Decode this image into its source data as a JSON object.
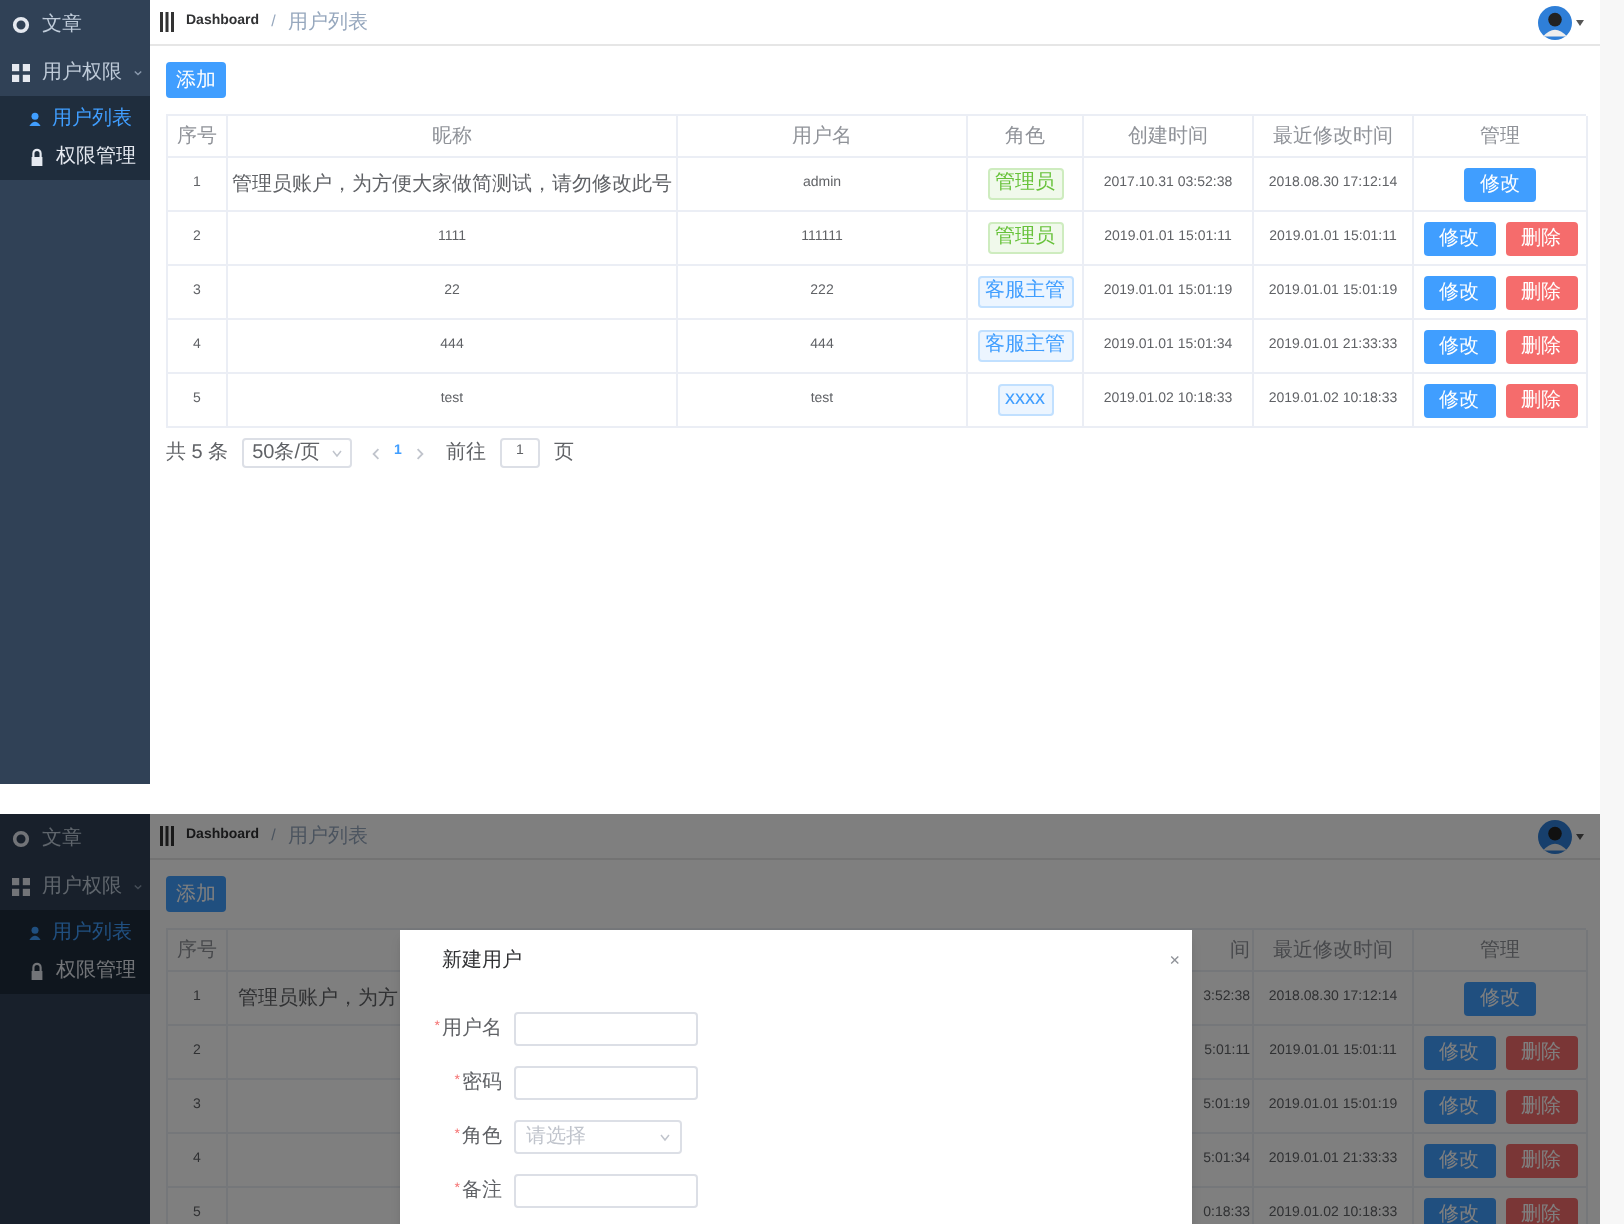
{
  "screens": [
    {
      "kind": "list",
      "sidebar": {
        "items": [
          {
            "label": "文章"
          },
          {
            "label": "用户权限",
            "expanded": true,
            "children": [
              {
                "label": "用户列表",
                "selected": true
              },
              {
                "label": "权限管理",
                "selected": false
              }
            ]
          }
        ]
      },
      "breadcrumb": {
        "items": [
          "Dashboard",
          "用户列表"
        ],
        "separator": "/"
      },
      "add_button": "添加",
      "table": {
        "columns": {
          "index": "序号",
          "nickname": "昵称",
          "username": "用户名",
          "role": "角色",
          "created": "创建时间",
          "modified": "最近修改时间",
          "actions": "管理"
        },
        "rows": [
          {
            "index": "1",
            "nickname": "管理员账户，为方便大家做简测试，请勿修改此号",
            "username": "admin",
            "role": {
              "label": "管理员",
              "color": "#67c23a"
            },
            "created": "2017.10.31 03:52:38",
            "modified": "2018.08.30 17:12:14",
            "actions": [
              {
                "label": "修改",
                "kind": "edit"
              }
            ]
          },
          {
            "index": "2",
            "nickname": "1111",
            "username": "111111",
            "role": {
              "label": "管理员",
              "color": "#67c23a"
            },
            "created": "2019.01.01 15:01:11",
            "modified": "2019.01.01 15:01:11",
            "actions": [
              {
                "label": "修改",
                "kind": "edit"
              },
              {
                "label": "删除",
                "kind": "delete"
              }
            ]
          },
          {
            "index": "3",
            "nickname": "22",
            "username": "222",
            "role": {
              "label": "客服主管",
              "color": "#409eff"
            },
            "created": "2019.01.01 15:01:19",
            "modified": "2019.01.01 15:01:19",
            "actions": [
              {
                "label": "修改",
                "kind": "edit"
              },
              {
                "label": "删除",
                "kind": "delete"
              }
            ]
          },
          {
            "index": "4",
            "nickname": "444",
            "username": "444",
            "role": {
              "label": "客服主管",
              "color": "#409eff"
            },
            "created": "2019.01.01 15:01:34",
            "modified": "2019.01.01 21:33:33",
            "actions": [
              {
                "label": "修改",
                "kind": "edit"
              },
              {
                "label": "删除",
                "kind": "delete"
              }
            ]
          },
          {
            "index": "5",
            "nickname": "test",
            "username": "test",
            "role": {
              "label": "xxxx",
              "color": "#409eff"
            },
            "created": "2019.01.02 10:18:33",
            "modified": "2019.01.02 10:18:33",
            "actions": [
              {
                "label": "修改",
                "kind": "edit"
              },
              {
                "label": "删除",
                "kind": "delete"
              }
            ]
          }
        ]
      },
      "pagination": {
        "total": "共 5 条",
        "page_size": "50条/页",
        "pages": [
          {
            "label": "1",
            "selected": true
          }
        ],
        "goto": "前往",
        "goto_value": "1",
        "suffix": "页"
      }
    },
    {
      "kind": "dialog",
      "sidebar": {
        "items": [
          {
            "label": "文章"
          },
          {
            "label": "用户权限",
            "expanded": true,
            "children": [
              {
                "label": "用户列表",
                "selected": true
              },
              {
                "label": "权限管理",
                "selected": false
              }
            ]
          }
        ]
      },
      "breadcrumb": {
        "items": [
          "Dashboard",
          "用户列表"
        ],
        "separator": "/"
      },
      "add_button": "添加",
      "table": {
        "columns": {
          "index": "序号",
          "created": "间",
          "modified": "最近修改时间",
          "actions": "管理"
        },
        "rows": [
          {
            "index": "1",
            "nickname": "管理员账户，为方",
            "created": "3:52:38",
            "modified": "2018.08.30 17:12:14",
            "actions": [
              {
                "label": "修改",
                "kind": "edit"
              }
            ]
          },
          {
            "index": "2",
            "created": "5:01:11",
            "modified": "2019.01.01 15:01:11",
            "actions": [
              {
                "label": "修改",
                "kind": "edit"
              },
              {
                "label": "删除",
                "kind": "delete"
              }
            ]
          },
          {
            "index": "3",
            "created": "5:01:19",
            "modified": "2019.01.01 15:01:19",
            "actions": [
              {
                "label": "修改",
                "kind": "edit"
              },
              {
                "label": "删除",
                "kind": "delete"
              }
            ]
          },
          {
            "index": "4",
            "created": "5:01:34",
            "modified": "2019.01.01 21:33:33",
            "actions": [
              {
                "label": "修改",
                "kind": "edit"
              },
              {
                "label": "删除",
                "kind": "delete"
              }
            ]
          },
          {
            "index": "5",
            "created": "0:18:33",
            "modified": "2019.01.02 10:18:33",
            "actions": [
              {
                "label": "修改",
                "kind": "edit"
              },
              {
                "label": "删除",
                "kind": "delete"
              }
            ]
          }
        ]
      },
      "dialog": {
        "title": "新建用户",
        "close": "×",
        "fields": [
          {
            "kind": "input",
            "required_mark": "*",
            "label": "用户名"
          },
          {
            "kind": "input",
            "required_mark": "*",
            "label": "密码"
          },
          {
            "kind": "select",
            "required_mark": "*",
            "label": "角色",
            "placeholder": "请选择"
          },
          {
            "kind": "input",
            "required_mark": "*",
            "label": "备注"
          }
        ]
      }
    }
  ]
}
